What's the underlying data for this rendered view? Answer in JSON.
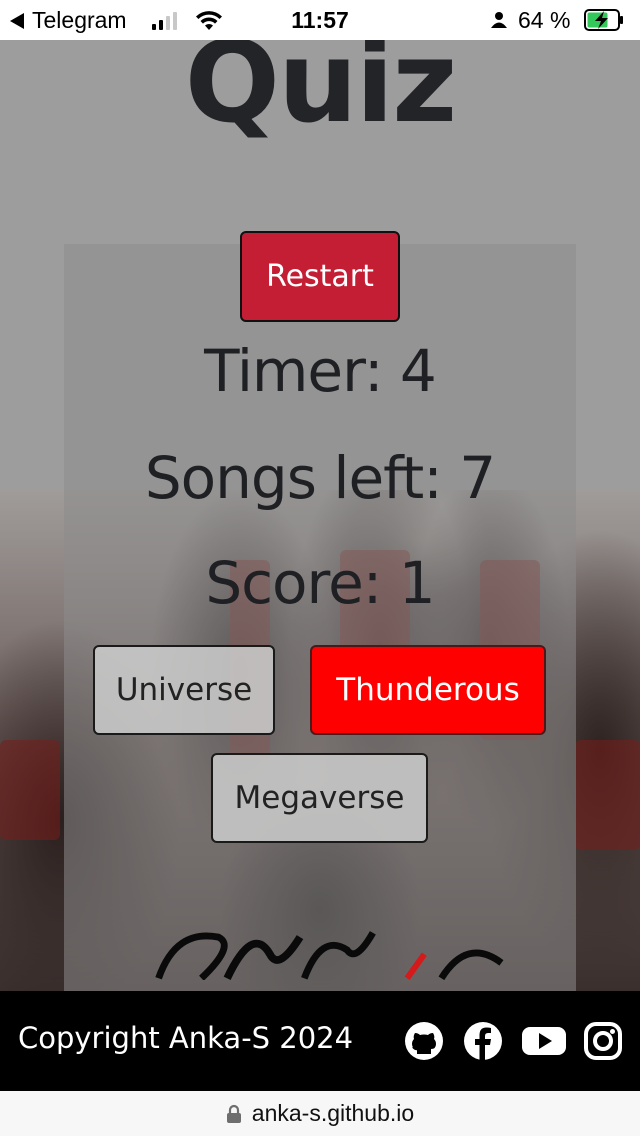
{
  "status_bar": {
    "back_app": "Telegram",
    "time": "11:57",
    "battery": "64 %"
  },
  "page": {
    "title": "Quiz",
    "restart_label": "Restart",
    "timer_text": "Timer: 4",
    "songs_left_text": "Songs left: 7",
    "score_text": "Score: 1",
    "answers": [
      "Universe",
      "Thunderous",
      "Megaverse"
    ],
    "selected_answer_color": "#ff0000",
    "restart_color": "#c41e35"
  },
  "footer": {
    "copyright": "Copyright Anka-S 2024",
    "social_icons": [
      "github-icon",
      "facebook-icon",
      "youtube-icon",
      "instagram-icon"
    ]
  },
  "address_bar": {
    "url": "anka-s.github.io"
  }
}
